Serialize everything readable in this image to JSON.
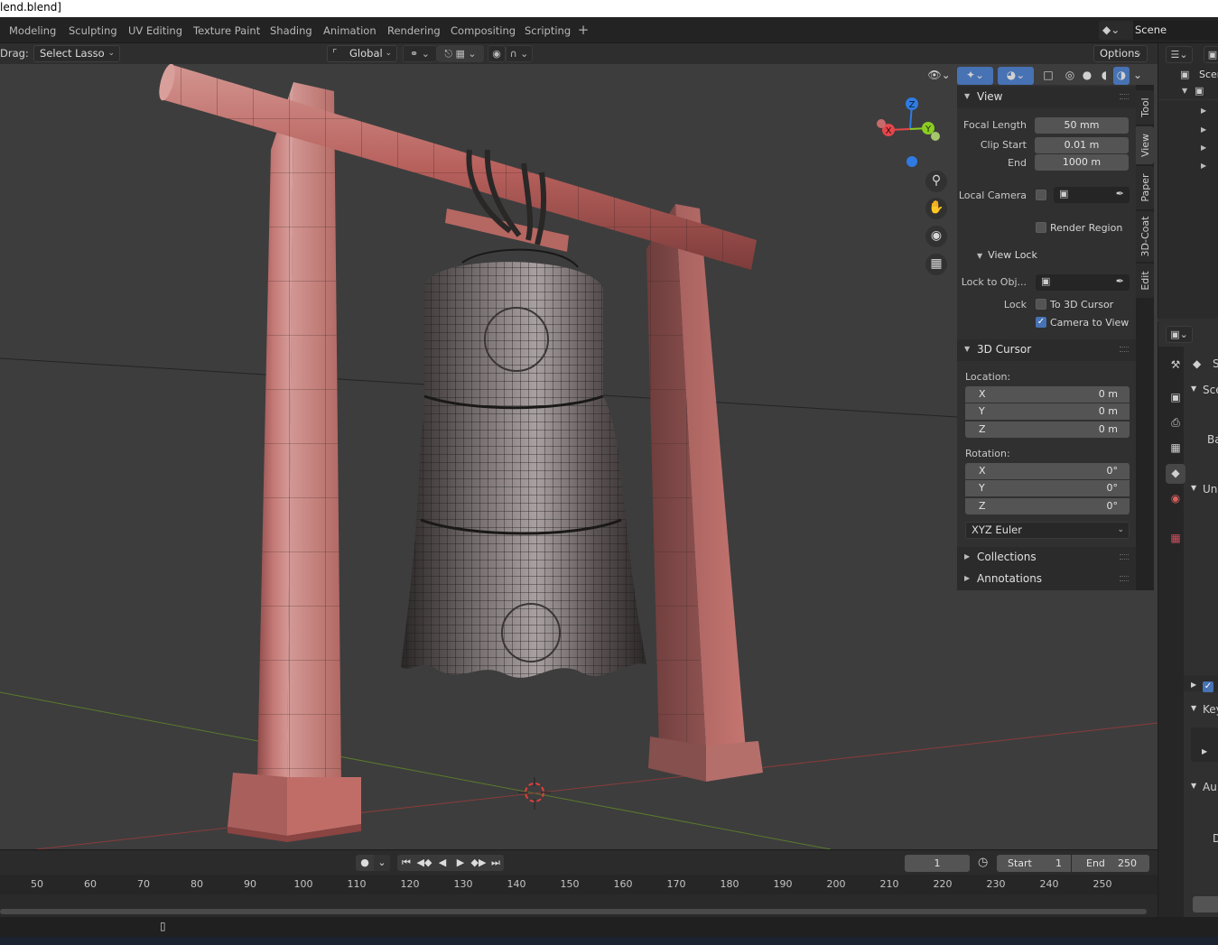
{
  "window": {
    "title": "lend.blend]"
  },
  "workspaces": [
    "Modeling",
    "Sculpting",
    "UV Editing",
    "Texture Paint",
    "Shading",
    "Animation",
    "Rendering",
    "Compositing",
    "Scripting"
  ],
  "scene_name": "Scene",
  "header": {
    "drag_label": "Drag:",
    "drag_value": "Select Lasso",
    "orientation": "Global",
    "options_label": "Options"
  },
  "npanel": {
    "tabs": [
      "Tool",
      "View",
      "Paper",
      "3D-Coat",
      "Edit"
    ],
    "view": {
      "title": "View",
      "focal_length_label": "Focal Length",
      "focal_length": "50 mm",
      "clip_start_label": "Clip Start",
      "clip_start": "0.01 m",
      "end_label": "End",
      "end": "1000 m",
      "local_camera_label": "Local Camera",
      "render_region_label": "Render Region",
      "view_lock_title": "View Lock",
      "lock_to_obj_label": "Lock to Obj...",
      "lock_label": "Lock",
      "to_3d_cursor_label": "To 3D Cursor",
      "camera_to_view_label": "Camera to View"
    },
    "cursor": {
      "title": "3D Cursor",
      "location_label": "Location:",
      "location": [
        {
          "axis": "X",
          "value": "0 m"
        },
        {
          "axis": "Y",
          "value": "0 m"
        },
        {
          "axis": "Z",
          "value": "0 m"
        }
      ],
      "rotation_label": "Rotation:",
      "rotation": [
        {
          "axis": "X",
          "value": "0°"
        },
        {
          "axis": "Y",
          "value": "0°"
        },
        {
          "axis": "Z",
          "value": "0°"
        }
      ],
      "rotation_mode": "XYZ Euler"
    },
    "collections_label": "Collections",
    "annotations_label": "Annotations"
  },
  "gizmo": {
    "x": "X",
    "y": "Y",
    "z": "Z"
  },
  "outliner": {
    "scene_label": "Scen"
  },
  "properties": {
    "labels": [
      "S",
      "Sce",
      "Ba",
      "Uni",
      "Key",
      "Au",
      "D"
    ]
  },
  "timeline": {
    "current_frame": "1",
    "start_label": "Start",
    "start": "1",
    "end_label": "End",
    "end": "250",
    "ticks": [
      "50",
      "60",
      "70",
      "80",
      "90",
      "100",
      "110",
      "120",
      "130",
      "140",
      "150",
      "160",
      "170",
      "180",
      "190",
      "200",
      "210",
      "220",
      "230",
      "240",
      "250"
    ]
  },
  "colors": {
    "accent": "#4772b3",
    "x_axis": "#e5464b",
    "y_axis": "#8bcd23",
    "z_axis": "#2f7be2",
    "wood": "#b65f5d"
  }
}
